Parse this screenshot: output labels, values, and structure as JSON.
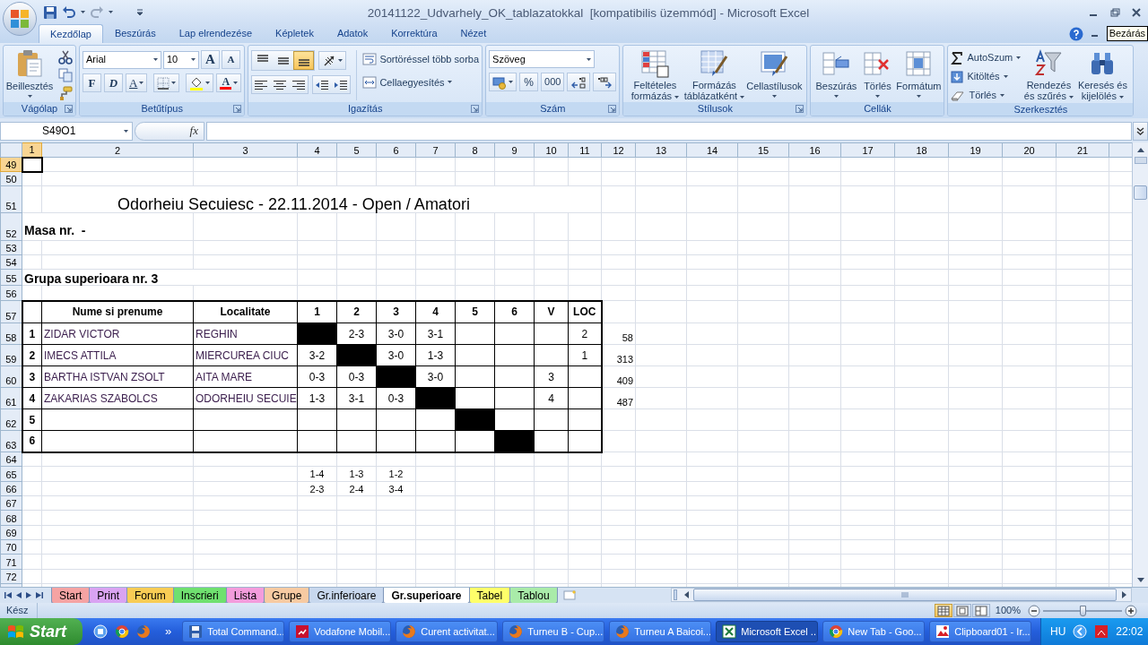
{
  "title_bar": {
    "title": "20141122_Udvarhely_OK_tablazatokkal  [kompatibilis üzemmód] - Microsoft Excel"
  },
  "tooltip": "Bezárás",
  "ribbon_tabs": [
    {
      "label": "Kezdőlap",
      "selected": true
    },
    {
      "label": "Beszúrás",
      "selected": false
    },
    {
      "label": "Lap elrendezése",
      "selected": false
    },
    {
      "label": "Képletek",
      "selected": false
    },
    {
      "label": "Adatok",
      "selected": false
    },
    {
      "label": "Korrektúra",
      "selected": false
    },
    {
      "label": "Nézet",
      "selected": false
    }
  ],
  "clipboard": {
    "label": "Vágólap",
    "paste": "Beillesztés"
  },
  "font": {
    "label": "Betűtípus",
    "font_name": "Arial",
    "font_size": "10",
    "grow": "A",
    "shrink": "A",
    "bold": "F",
    "italic": "D",
    "underline": "A",
    "font_color": "A"
  },
  "alignment": {
    "label": "Igazítás",
    "vertical": [
      {
        "on": false
      },
      {
        "on": false
      },
      {
        "on": true
      }
    ],
    "wrap_text": "Sortöréssel több sorba",
    "merge": "Cellaegyesítés"
  },
  "number": {
    "label": "Szám",
    "format": "Szöveg",
    "percent": "%",
    "thousands": "000"
  },
  "styles": {
    "label": "Stílusok",
    "buttons": [
      "Feltételes formázás",
      "Formázás táblázatként",
      "Cellastílusok"
    ]
  },
  "cells": {
    "label": "Cellák",
    "buttons": [
      "Beszúrás",
      "Törlés",
      "Formátum"
    ]
  },
  "editing": {
    "label": "Szerkesztés",
    "small": [
      "AutoSzum",
      "Kitöltés",
      "Törlés"
    ],
    "buttons": [
      "Rendezés és szűrés",
      "Keresés és kijelölés"
    ]
  },
  "formula_bar": {
    "name_box": "S49O1",
    "fx": "fx"
  },
  "column_headers": [
    {
      "label": "1",
      "selected": true
    },
    {
      "label": "2",
      "selected": false
    },
    {
      "label": "3",
      "selected": false
    },
    {
      "label": "4",
      "selected": false
    },
    {
      "label": "5",
      "selected": false
    },
    {
      "label": "6",
      "selected": false
    },
    {
      "label": "7",
      "selected": false
    },
    {
      "label": "8",
      "selected": false
    },
    {
      "label": "9",
      "selected": false
    },
    {
      "label": "10",
      "selected": false
    },
    {
      "label": "11",
      "selected": false
    },
    {
      "label": "12",
      "selected": false
    },
    {
      "label": "13",
      "selected": false
    },
    {
      "label": "14",
      "selected": false
    },
    {
      "label": "15",
      "selected": false
    },
    {
      "label": "16",
      "selected": false
    },
    {
      "label": "17",
      "selected": false
    },
    {
      "label": "18",
      "selected": false
    },
    {
      "label": "19",
      "selected": false
    },
    {
      "label": "20",
      "selected": false
    },
    {
      "label": "21",
      "selected": false
    }
  ],
  "row_headers": [
    {
      "label": "49",
      "selected": true
    },
    {
      "label": "50",
      "selected": false
    },
    {
      "label": "51",
      "selected": false
    },
    {
      "label": "52",
      "selected": false
    },
    {
      "label": "53",
      "selected": false
    },
    {
      "label": "54",
      "selected": false
    },
    {
      "label": "55",
      "selected": false
    },
    {
      "label": "56",
      "selected": false
    },
    {
      "label": "57",
      "selected": false
    },
    {
      "label": "58",
      "selected": false
    },
    {
      "label": "59",
      "selected": false
    },
    {
      "label": "60",
      "selected": false
    },
    {
      "label": "61",
      "selected": false
    },
    {
      "label": "62",
      "selected": false
    },
    {
      "label": "63",
      "selected": false
    },
    {
      "label": "64",
      "selected": false
    },
    {
      "label": "65",
      "selected": false
    },
    {
      "label": "66",
      "selected": false
    },
    {
      "label": "67",
      "selected": false
    },
    {
      "label": "68",
      "selected": false
    },
    {
      "label": "69",
      "selected": false
    },
    {
      "label": "70",
      "selected": false
    },
    {
      "label": "71",
      "selected": false
    },
    {
      "label": "72",
      "selected": false
    }
  ],
  "sheet": {
    "title": "Odorheiu Secuiesc - 22.11.2014 - Open / Amatori",
    "table_no": "Masa nr.  -",
    "group": "Grupa superioara nr. 3",
    "standings": {
      "columns": [
        "Nume si prenume",
        "Localitate",
        "1",
        "2",
        "3",
        "4",
        "5",
        "6",
        "V",
        "LOC"
      ],
      "rows": [
        {
          "no": "1",
          "name": "ZIDAR VICTOR",
          "locality": "REGHIN",
          "results": [
            {
              "kind": "self"
            },
            {
              "kind": "score",
              "score": "2-3"
            },
            {
              "kind": "score",
              "score": "3-0"
            },
            {
              "kind": "score",
              "score": "3-1"
            },
            {
              "kind": "empty"
            },
            {
              "kind": "empty"
            }
          ],
          "loc": "2",
          "side": "58"
        },
        {
          "no": "2",
          "name": "IMECS ATTILA",
          "locality": "MIERCUREA CIUC",
          "results": [
            {
              "kind": "score",
              "score": "3-2"
            },
            {
              "kind": "self"
            },
            {
              "kind": "score",
              "score": "3-0"
            },
            {
              "kind": "score",
              "score": "1-3"
            },
            {
              "kind": "empty"
            },
            {
              "kind": "empty"
            }
          ],
          "loc": "1",
          "side": "313"
        },
        {
          "no": "3",
          "name": "BARTHA ISTVAN ZSOLT",
          "locality": "AITA MARE",
          "results": [
            {
              "kind": "score",
              "score": "0-3"
            },
            {
              "kind": "score",
              "score": "0-3"
            },
            {
              "kind": "self"
            },
            {
              "kind": "score",
              "score": "3-0"
            },
            {
              "kind": "empty"
            },
            {
              "kind": "empty"
            }
          ],
          "v": "3",
          "side": "409"
        },
        {
          "no": "4",
          "name": "ZAKARIAS SZABOLCS",
          "locality": "ODORHEIU SECUIE",
          "results": [
            {
              "kind": "score",
              "score": "1-3"
            },
            {
              "kind": "score",
              "score": "3-1"
            },
            {
              "kind": "score",
              "score": "0-3"
            },
            {
              "kind": "self"
            },
            {
              "kind": "empty"
            },
            {
              "kind": "empty"
            }
          ],
          "v": "4",
          "side": "487"
        },
        {
          "no": "5",
          "results": [
            {
              "kind": "empty"
            },
            {
              "kind": "empty"
            },
            {
              "kind": "empty"
            },
            {
              "kind": "empty"
            },
            {
              "kind": "self"
            },
            {
              "kind": "empty"
            }
          ]
        },
        {
          "no": "6",
          "results": [
            {
              "kind": "empty"
            },
            {
              "kind": "empty"
            },
            {
              "kind": "empty"
            },
            {
              "kind": "empty"
            },
            {
              "kind": "empty"
            },
            {
              "kind": "self"
            }
          ]
        }
      ]
    },
    "pairings": [
      [
        "1-4",
        "1-3",
        "1-2"
      ],
      [
        "2-3",
        "2-4",
        "3-4"
      ]
    ]
  },
  "sheet_tabs": [
    {
      "label": "Start",
      "color": "#f5a3a3",
      "selected": false
    },
    {
      "label": "Print",
      "color": "#d9a3f2",
      "selected": false
    },
    {
      "label": "Forum",
      "color": "#f8cc55",
      "selected": false
    },
    {
      "label": "Inscrieri",
      "color": "#6fe06f",
      "selected": false
    },
    {
      "label": "Lista",
      "color": "#f39cdc",
      "selected": false
    },
    {
      "label": "Grupe",
      "color": "#f7caa2",
      "selected": false
    },
    {
      "label": "Gr.inferioare",
      "color": "#c8d8ee",
      "selected": false
    },
    {
      "label": "Gr.superioare",
      "color": "#ffffff",
      "selected": true
    },
    {
      "label": "Tabel",
      "color": "#ffff6a",
      "selected": false
    },
    {
      "label": "Tablou",
      "color": "#a9eba9",
      "selected": false
    }
  ],
  "status_bar": {
    "status": "Kész",
    "views": [
      {
        "selected": true
      },
      {
        "selected": false
      },
      {
        "selected": false
      }
    ],
    "zoom": "100%",
    "level": 0.5
  },
  "taskbar": {
    "start": "Start",
    "chevron": "»",
    "tasks": [
      {
        "label": "Total Command...",
        "selected": false
      },
      {
        "label": "Vodafone Mobil...",
        "selected": false
      },
      {
        "label": "Curent activitat...",
        "selected": false
      },
      {
        "label": "Turneu B - Cup...",
        "selected": false
      },
      {
        "label": "Turneu A Baicoi...",
        "selected": false
      },
      {
        "label": "Microsoft Excel ...",
        "selected": true
      },
      {
        "label": "New Tab - Goo...",
        "selected": false
      },
      {
        "label": "Clipboard01 - Ir...",
        "selected": false
      }
    ],
    "language": "HU",
    "clock": "22:02"
  }
}
